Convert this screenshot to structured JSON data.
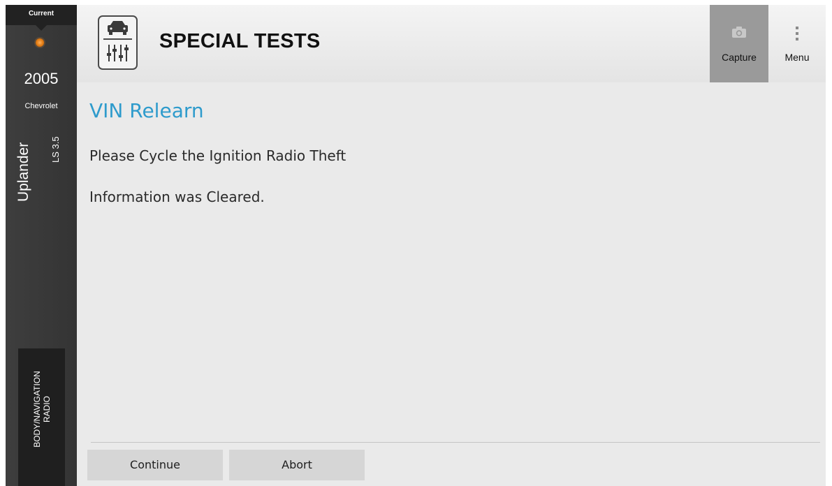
{
  "sidebar": {
    "current_label": "Current",
    "year": "2005",
    "make": "Chevrolet",
    "model": "Uplander",
    "trim": "LS 3.5",
    "module_line1": "BODY/NAVIGATION",
    "module_line2": "RADIO",
    "status_color": "#e07a12"
  },
  "header": {
    "title": "SPECIAL TESTS",
    "app_icon": "car-settings-icon",
    "capture_label": "Capture",
    "capture_icon": "camera-icon",
    "menu_label": "Menu",
    "menu_icon": "vertical-dots-icon"
  },
  "content": {
    "test_title": "VIN Relearn",
    "messages": [
      "Please Cycle the Ignition Radio Theft",
      "Information was Cleared."
    ],
    "title_color": "#2e9bcc"
  },
  "actions": {
    "continue_label": "Continue",
    "abort_label": "Abort"
  }
}
